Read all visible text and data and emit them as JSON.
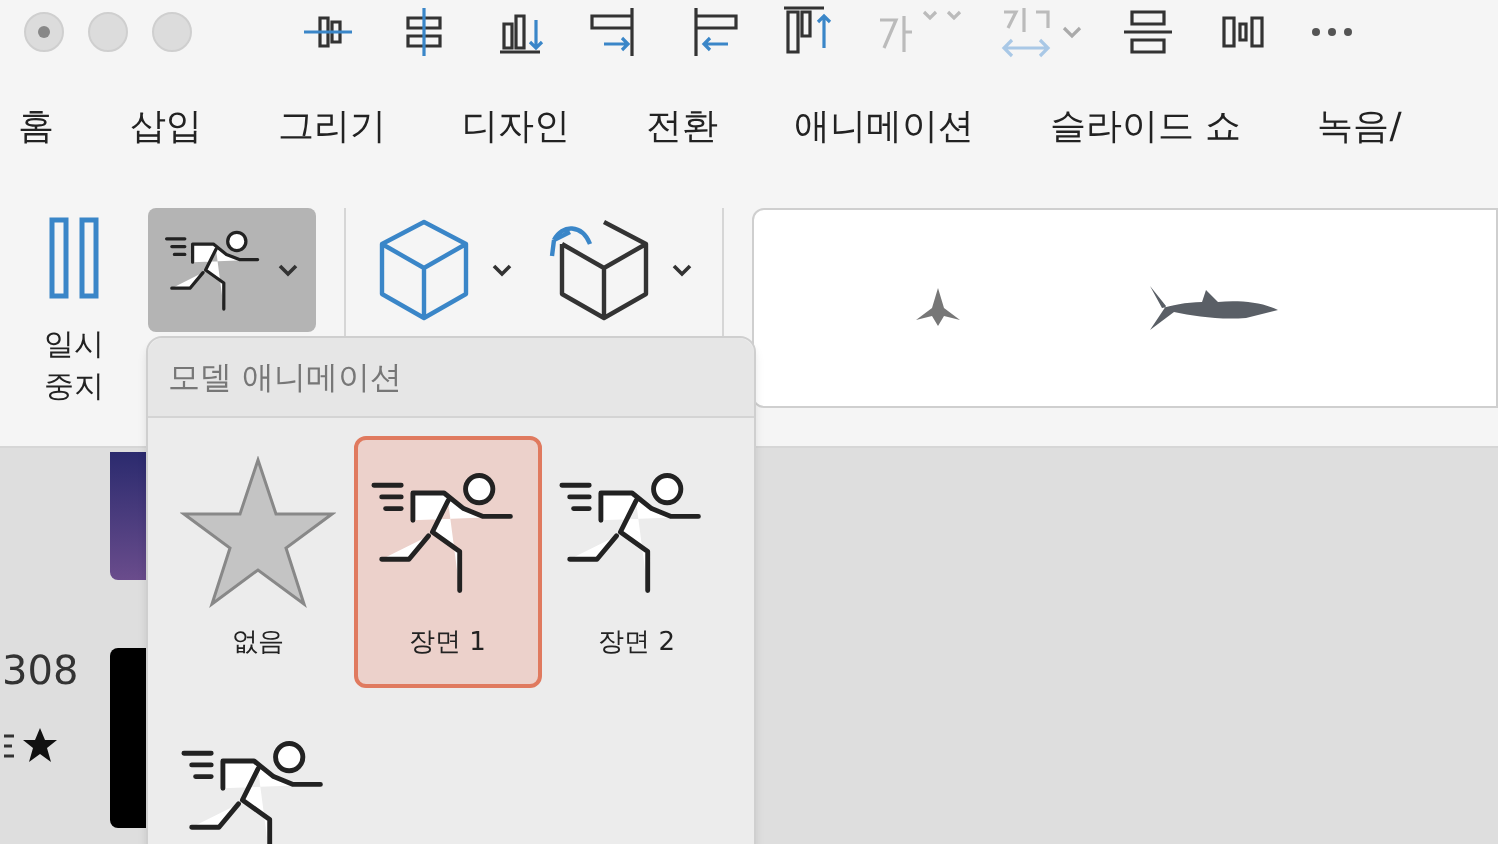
{
  "tabs": [
    {
      "label": "홈"
    },
    {
      "label": "삽입"
    },
    {
      "label": "그리기"
    },
    {
      "label": "디자인"
    },
    {
      "label": "전환"
    },
    {
      "label": "애니메이션"
    },
    {
      "label": "슬라이드 쇼"
    },
    {
      "label": "녹음/"
    }
  ],
  "ribbon": {
    "pause_label": "일시 중지"
  },
  "slides": {
    "number": "308"
  },
  "menu": {
    "title": "모델 애니메이션",
    "items": [
      {
        "kind": "none",
        "label": "없음",
        "selected": false
      },
      {
        "kind": "runner",
        "label": "장면 1",
        "selected": true
      },
      {
        "kind": "runner",
        "label": "장면 2",
        "selected": false
      },
      {
        "kind": "runner",
        "selected": false
      }
    ]
  }
}
